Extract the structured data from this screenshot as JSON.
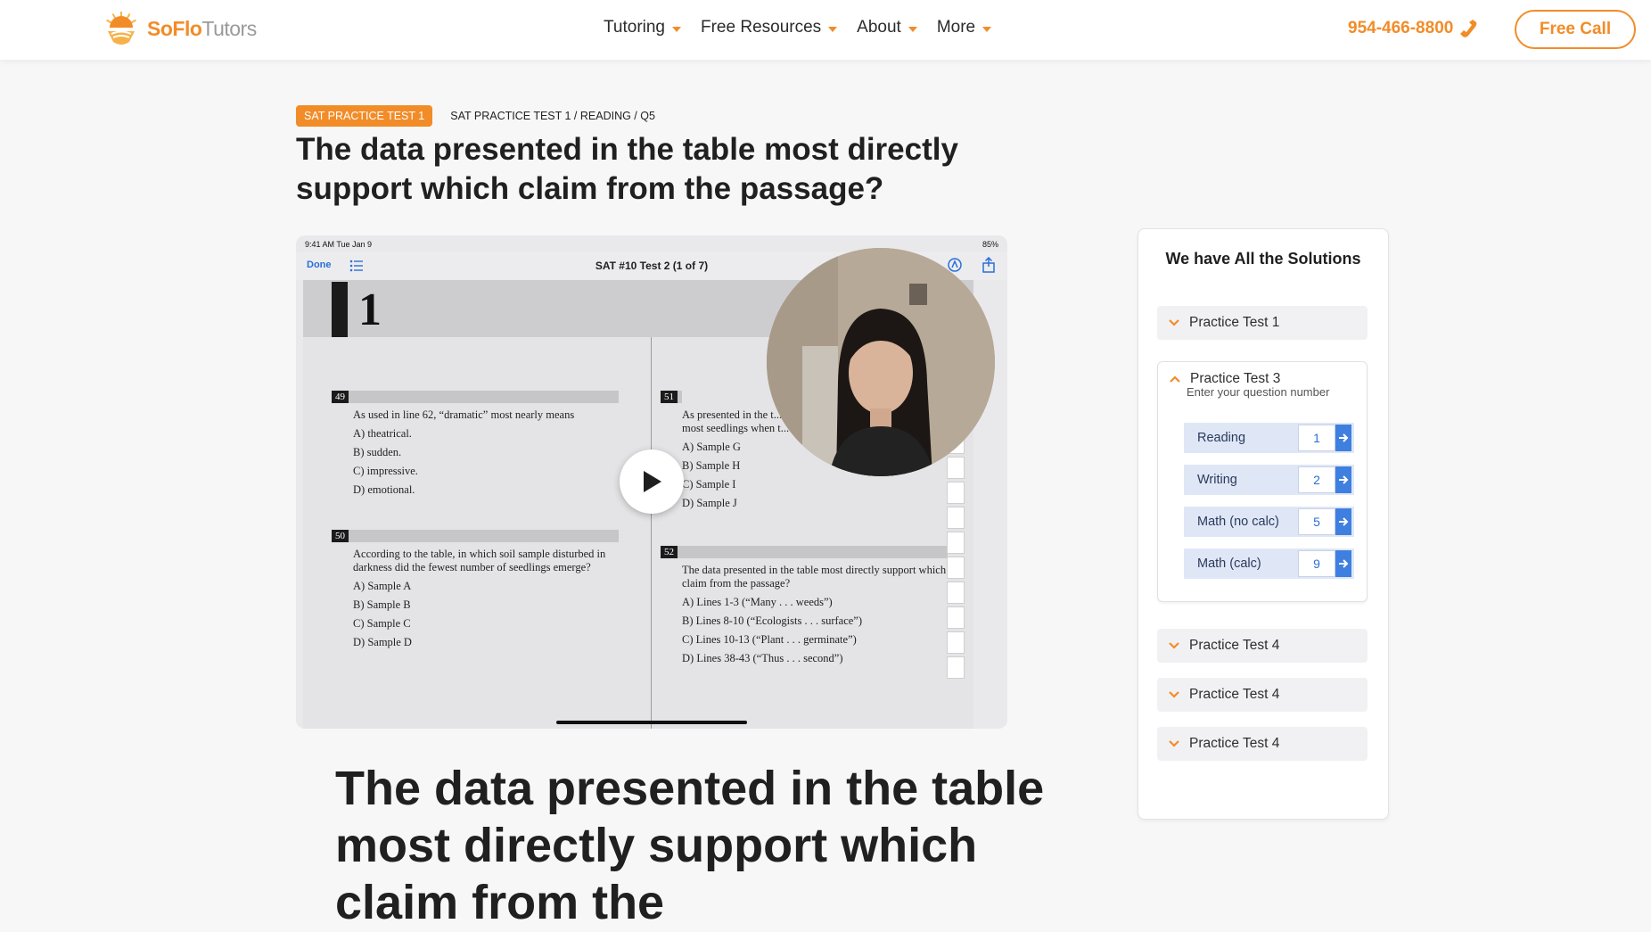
{
  "header": {
    "logo_brand": "SoFlo",
    "logo_suffix": "Tutors",
    "nav": [
      {
        "label": "Tutoring"
      },
      {
        "label": "Free Resources"
      },
      {
        "label": "About"
      },
      {
        "label": "More"
      }
    ],
    "phone": "954-466-8800",
    "cta_label": "Free Call"
  },
  "colors": {
    "accent": "#f28c28",
    "link_blue": "#2a6fd6",
    "section_bg": "#dfe7f7"
  },
  "breadcrumb": {
    "badge": "SAT PRACTICE TEST 1",
    "path": "SAT PRACTICE TEST 1 / READING / Q5"
  },
  "question_title": "The data presented in the table most directly support which claim from the passage?",
  "video": {
    "status_time": "9:41 AM   Tue Jan 9",
    "status_battery": "85%",
    "done_label": "Done",
    "doc_title": "SAT #10 Test 2 (1 of 7)",
    "section_number": "1",
    "questions": [
      {
        "num": "49",
        "stem": "As used in line 62, “dramatic” most nearly means",
        "options": [
          "A)  theatrical.",
          "B)  sudden.",
          "C)  impressive.",
          "D)  emotional."
        ]
      },
      {
        "num": "50",
        "stem": "According to the table, in which soil sample disturbed in darkness did the fewest number of seedlings emerge?",
        "options": [
          "A)  Sample A",
          "B)  Sample B",
          "C)  Sample C",
          "D)  Sample D"
        ]
      },
      {
        "num": "51",
        "stem": "As presented in the t... most seedlings when t...",
        "options": [
          "A)  Sample G",
          "B)  Sample H",
          "C)  Sample I",
          "D)  Sample J"
        ]
      },
      {
        "num": "52",
        "stem": "The data presented in the table most directly support which claim from the passage?",
        "options": [
          "A)  Lines 1-3 (“Many . . . weeds”)",
          "B)  Lines 8-10 (“Ecologists . . . surface”)",
          "C)  Lines 10-13 (“Plant . . . germinate”)",
          "D)  Lines 38-43 (“Thus . . . second”)"
        ]
      }
    ]
  },
  "big_title": "The data presented in the table most directly support which claim from the",
  "sidebar": {
    "title": "We have All the Solutions",
    "items": [
      {
        "label": "Practice Test 1"
      },
      {
        "label": "Practice Test 3",
        "subtitle": "Enter your question number"
      },
      {
        "label": "Practice Test 4"
      },
      {
        "label": "Practice Test 4"
      },
      {
        "label": "Practice Test 4"
      }
    ],
    "sections": [
      {
        "label": "Reading",
        "value": "1"
      },
      {
        "label": "Writing",
        "value": "2"
      },
      {
        "label": "Math (no calc)",
        "value": "5"
      },
      {
        "label": "Math (calc)",
        "value": "9"
      }
    ]
  }
}
